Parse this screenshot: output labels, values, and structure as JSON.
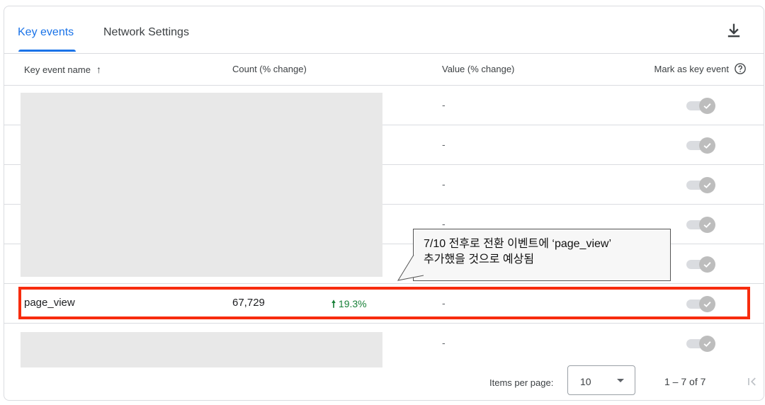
{
  "tabs": {
    "key_events": "Key events",
    "network_settings": "Network Settings"
  },
  "table": {
    "headers": {
      "name": "Key event name",
      "name_sort": "↑",
      "count": "Count (% change)",
      "value": "Value (% change)",
      "mark": "Mark as key event"
    },
    "rows": [
      {
        "name": "",
        "count": "",
        "change": "",
        "value": "-",
        "key_event": true
      },
      {
        "name": "",
        "count": "",
        "change": "",
        "value": "-",
        "key_event": true
      },
      {
        "name": "",
        "count": "",
        "change": "",
        "value": "-",
        "key_event": true
      },
      {
        "name": "",
        "count": "",
        "change": "",
        "value": "-",
        "key_event": true
      },
      {
        "name": "",
        "count": "",
        "change": "",
        "value": "",
        "key_event": true
      },
      {
        "name": "page_view",
        "count": "67,729",
        "change": "19.3%",
        "change_arrow": "🠕",
        "value": "-",
        "key_event": true
      },
      {
        "name": "",
        "count": "",
        "change": "",
        "value": "-",
        "key_event": true
      }
    ]
  },
  "annotation": {
    "line1": "7/10 전후로 전환 이벤트에 ‘page_view’",
    "line2": "추가했을 것으로 예상됨"
  },
  "footer": {
    "items_per_page_label": "Items per page:",
    "items_per_page_value": "10",
    "range": "1 – 7 of 7"
  },
  "colors": {
    "accent": "#1a73e8",
    "positive": "#188038",
    "highlight": "#f72c0e"
  },
  "icons": {
    "download": "download-icon",
    "help": "help-circle-icon",
    "first_page": "first-page-icon",
    "check": "check-icon"
  }
}
